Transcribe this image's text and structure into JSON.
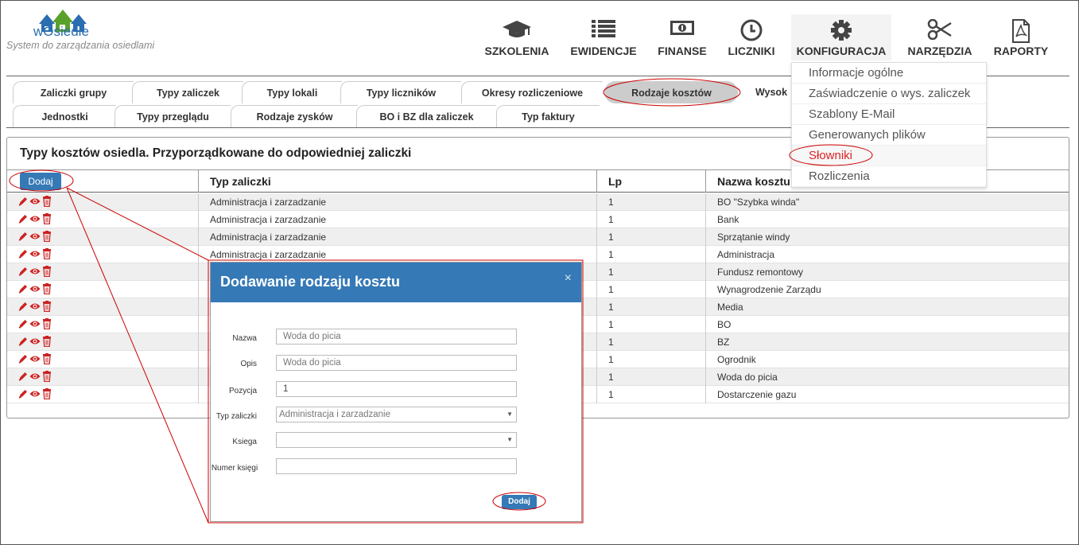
{
  "brand": {
    "name": "wOsiedle",
    "tagline": "System do zarządzania osiedlami"
  },
  "nav": [
    {
      "label": "SZKOLENIA",
      "icon": "graduation-cap-icon"
    },
    {
      "label": "EWIDENCJE",
      "icon": "list-icon"
    },
    {
      "label": "FINANSE",
      "icon": "money-icon"
    },
    {
      "label": "LICZNIKI",
      "icon": "clock-icon"
    },
    {
      "label": "KONFIGURACJA",
      "icon": "gear-icon"
    },
    {
      "label": "NARZĘDZIA",
      "icon": "scissors-icon"
    },
    {
      "label": "RAPORTY",
      "icon": "pdf-file-icon"
    }
  ],
  "config_menu": [
    "Informacje ogólne",
    "Zaświadczenie o wys. zaliczek",
    "Szablony E-Mail",
    "Generowanych plików",
    "Słowniki",
    "Rozliczenia"
  ],
  "tabs_row1": [
    "Zaliczki grupy",
    "Typy zaliczek",
    "Typy lokali",
    "Typy liczników",
    "Okresy rozliczeniowe",
    "Rodzaje kosztów",
    "Wysok"
  ],
  "tabs_row2": [
    "Jednostki",
    "Typy przeglądu",
    "Rodzaje zysków",
    "BO i BZ dla zaliczek",
    "Typ faktury"
  ],
  "panel": {
    "title": "Typy kosztów osiedla. Przyporządkowane do odpowiedniej zaliczki",
    "add_label": "Dodaj",
    "columns": [
      "Typ zaliczki",
      "Lp",
      "Nazwa kosztu"
    ],
    "rows": [
      [
        "Administracja i zarzadzanie",
        "1",
        "BO \"Szybka winda\""
      ],
      [
        "Administracja i zarzadzanie",
        "1",
        "Bank"
      ],
      [
        "Administracja i zarzadzanie",
        "1",
        "Sprzątanie windy"
      ],
      [
        "Administracja i zarzadzanie",
        "1",
        "Administracja"
      ],
      [
        "",
        "1",
        "Fundusz remontowy"
      ],
      [
        "",
        "1",
        "Wynagrodzenie Zarządu"
      ],
      [
        "",
        "1",
        "Media"
      ],
      [
        "",
        "1",
        "BO"
      ],
      [
        "",
        "1",
        "BZ"
      ],
      [
        "",
        "1",
        "Ogrodnik"
      ],
      [
        "",
        "1",
        "Woda do picia"
      ],
      [
        "",
        "1",
        "Dostarczenie gazu"
      ]
    ]
  },
  "modal": {
    "title": "Dodawanie rodzaju kosztu",
    "close": "×",
    "fields": [
      {
        "label": "Nazwa",
        "value": "",
        "placeholder": "Woda do picia"
      },
      {
        "label": "Opis",
        "value": "",
        "placeholder": "Woda do picia"
      },
      {
        "label": "Pozycja",
        "value": "1",
        "placeholder": ""
      },
      {
        "label": "Typ zaliczki",
        "value": "Administracja i zarzadzanie",
        "placeholder": ""
      },
      {
        "label": "Ksiega",
        "value": "",
        "placeholder": ""
      },
      {
        "label": "Numer księgi",
        "value": "",
        "placeholder": ""
      }
    ],
    "submit_label": "Dodaj"
  },
  "colors": {
    "primary": "#3579b6",
    "annotation": "#cc0000",
    "action_icon": "#cc2222"
  }
}
